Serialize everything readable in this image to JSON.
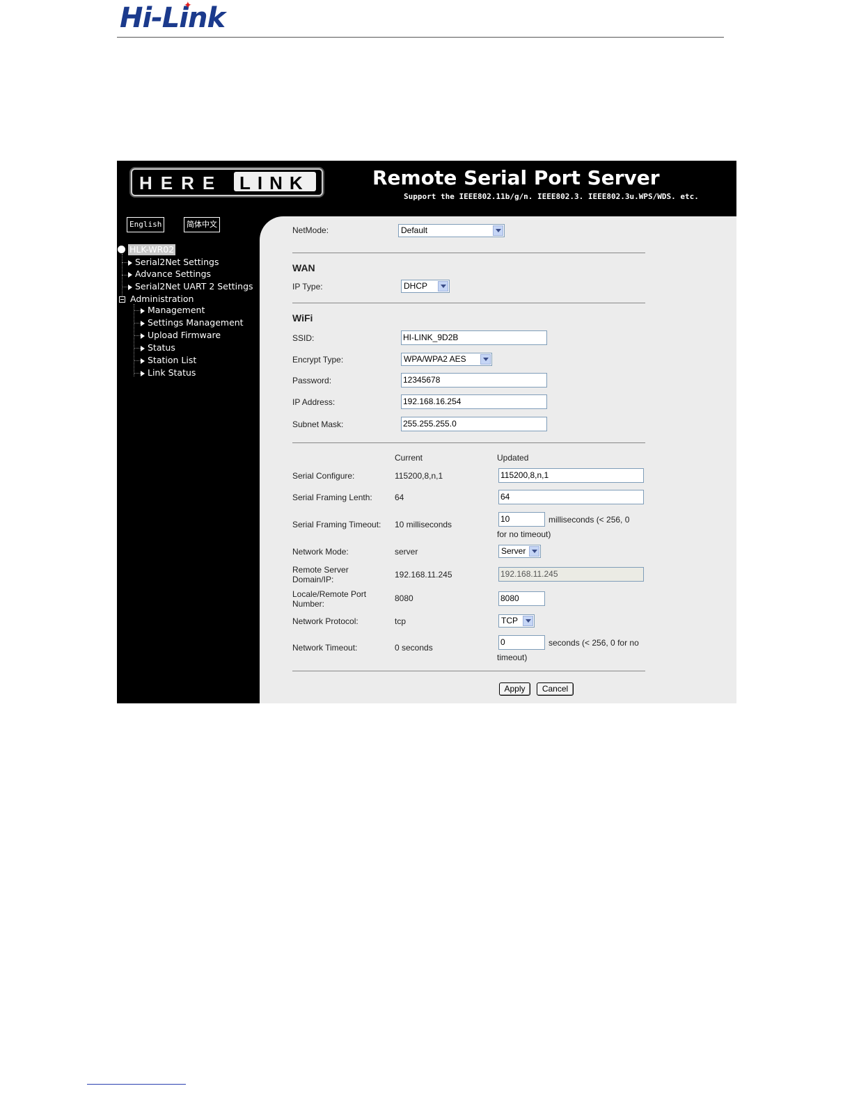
{
  "doc": {
    "logo_text": "Hi-Link"
  },
  "banner": {
    "brand_here": "HERE",
    "brand_link": "LINK",
    "title": "Remote Serial Port Server",
    "subtitle": "Support the IEEE802.11b/g/n. IEEE802.3. IEEE802.3u.WPS/WDS. etc."
  },
  "languages": {
    "english": "English",
    "chinese": "简体中文"
  },
  "nav": {
    "root": "HLK-WR02",
    "items": [
      "Serial2Net Settings",
      "Advance Settings",
      "Serial2Net UART 2 Settings",
      "Administration"
    ],
    "admin_items": [
      "Management",
      "Settings Management",
      "Upload Firmware",
      "Status",
      "Station List",
      "Link Status"
    ]
  },
  "form": {
    "netmode_label": "NetMode:",
    "netmode_value": "Default",
    "wan_header": "WAN",
    "ip_type_label": "IP Type:",
    "ip_type_value": "DHCP",
    "wifi_header": "WiFi",
    "ssid_label": "SSID:",
    "ssid_value": "HI-LINK_9D2B",
    "encrypt_label": "Encrypt Type:",
    "encrypt_value": "WPA/WPA2 AES",
    "password_label": "Password:",
    "password_value": "12345678",
    "ip_label": "IP Address:",
    "ip_value": "192.168.16.254",
    "mask_label": "Subnet Mask:",
    "mask_value": "255.255.255.0"
  },
  "serial": {
    "col_current": "Current",
    "col_updated": "Updated",
    "rows": {
      "configure": {
        "label": "Serial Configure:",
        "current": "115200,8,n,1",
        "updated": "115200,8,n,1"
      },
      "framing_len": {
        "label": "Serial Framing Lenth:",
        "current": "64",
        "updated": "64"
      },
      "framing_timeout": {
        "label": "Serial Framing Timeout:",
        "current": "10 milliseconds",
        "updated": "10",
        "hint_a": "milliseconds (< 256, 0",
        "hint_b": "for no timeout)"
      },
      "network_mode": {
        "label": "Network Mode:",
        "current": "server",
        "updated": "Server"
      },
      "remote_server": {
        "label_a": "Remote Server",
        "label_b": "Domain/IP:",
        "current": "192.168.11.245",
        "updated": "192.168.11.245"
      },
      "port": {
        "label_a": "Locale/Remote Port",
        "label_b": "Number:",
        "current": "8080",
        "updated": "8080"
      },
      "protocol": {
        "label": "Network Protocol:",
        "current": "tcp",
        "updated": "TCP"
      },
      "net_timeout": {
        "label": "Network Timeout:",
        "current": "0 seconds",
        "updated": "0",
        "hint_a": "seconds (< 256, 0 for no",
        "hint_b": "timeout)"
      }
    },
    "apply": "Apply",
    "cancel": "Cancel"
  }
}
